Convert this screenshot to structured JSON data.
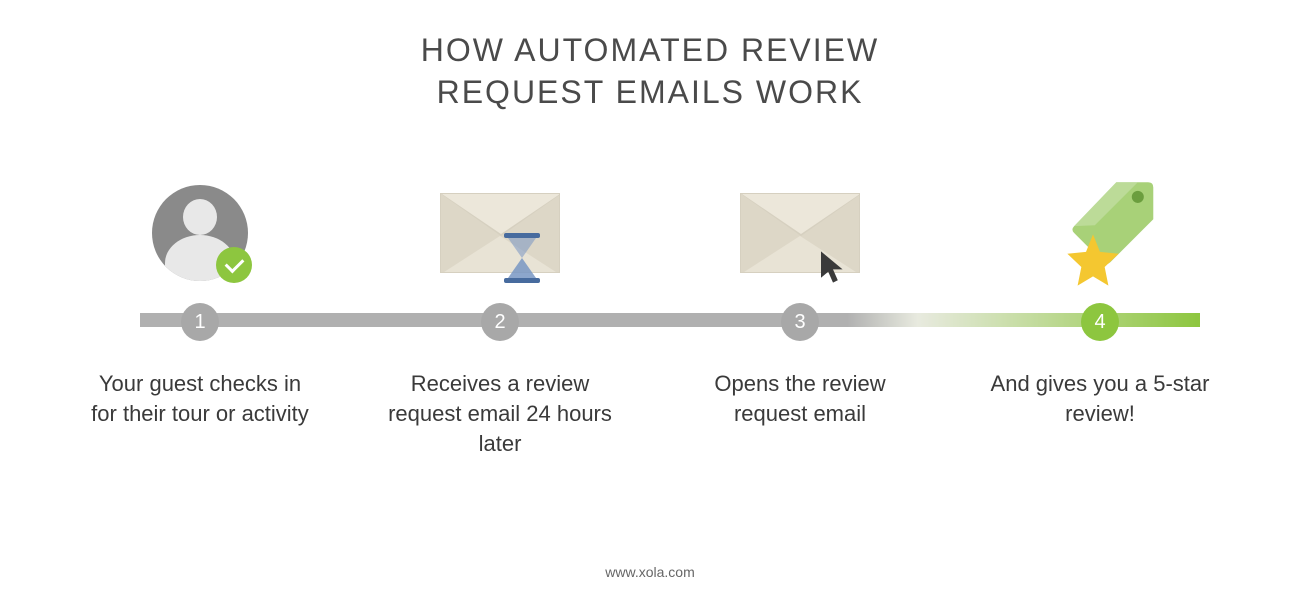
{
  "title_line1": "HOW AUTOMATED REVIEW",
  "title_line2": "REQUEST EMAILS WORK",
  "steps": [
    {
      "num": "1",
      "label": "Your guest checks in for their tour or activity",
      "icon": "avatar-check",
      "node_color": "gray"
    },
    {
      "num": "2",
      "label": "Receives a review request email 24 hours later",
      "icon": "envelope-hourglass",
      "node_color": "gray"
    },
    {
      "num": "3",
      "label": "Opens the review request email",
      "icon": "envelope-cursor",
      "node_color": "gray"
    },
    {
      "num": "4",
      "label": "And gives you a 5-star review!",
      "icon": "tag-star",
      "node_color": "green"
    }
  ],
  "footer": "www.xola.com",
  "colors": {
    "accent_green": "#8dc63f",
    "gray": "#a8a8a8",
    "text": "#4a4a4a"
  }
}
